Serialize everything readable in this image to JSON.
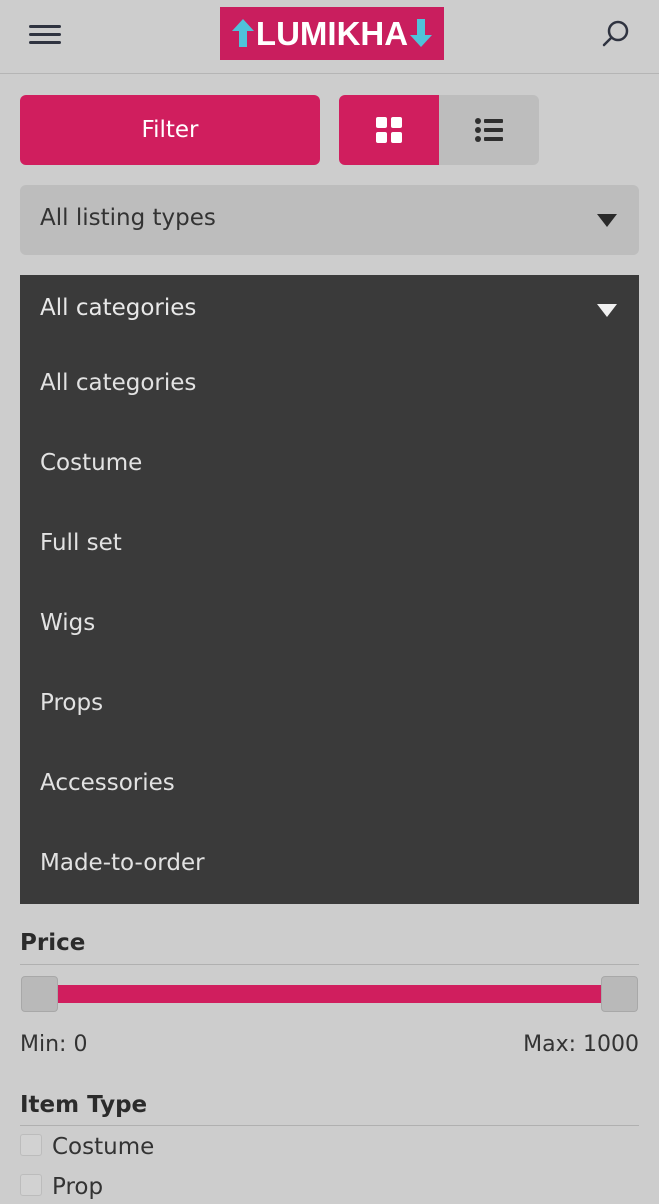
{
  "header": {
    "logo_text": "LUMIKHA",
    "menu_icon": "hamburger-menu-icon",
    "search_icon": "search-icon"
  },
  "toolbar": {
    "filter_label": "Filter",
    "grid_view_icon": "grid-view-icon",
    "list_view_icon": "list-view-icon"
  },
  "listing_type": {
    "selected": "All listing types"
  },
  "category": {
    "selected": "All categories",
    "options": [
      "All categories",
      "Costume",
      "Full set",
      "Wigs",
      "Props",
      "Accessories",
      "Made-to-order"
    ]
  },
  "price": {
    "title": "Price",
    "min_label": "Min: 0",
    "max_label": "Max: 1000",
    "min": 0,
    "max": 1000
  },
  "item_type": {
    "title": "Item Type",
    "options": [
      {
        "label": "Costume",
        "checked": false
      },
      {
        "label": "Prop",
        "checked": false
      }
    ]
  },
  "colors": {
    "accent": "#d01e5e",
    "background": "#cdcdcd",
    "dropdown_bg": "#3a3a3a"
  }
}
